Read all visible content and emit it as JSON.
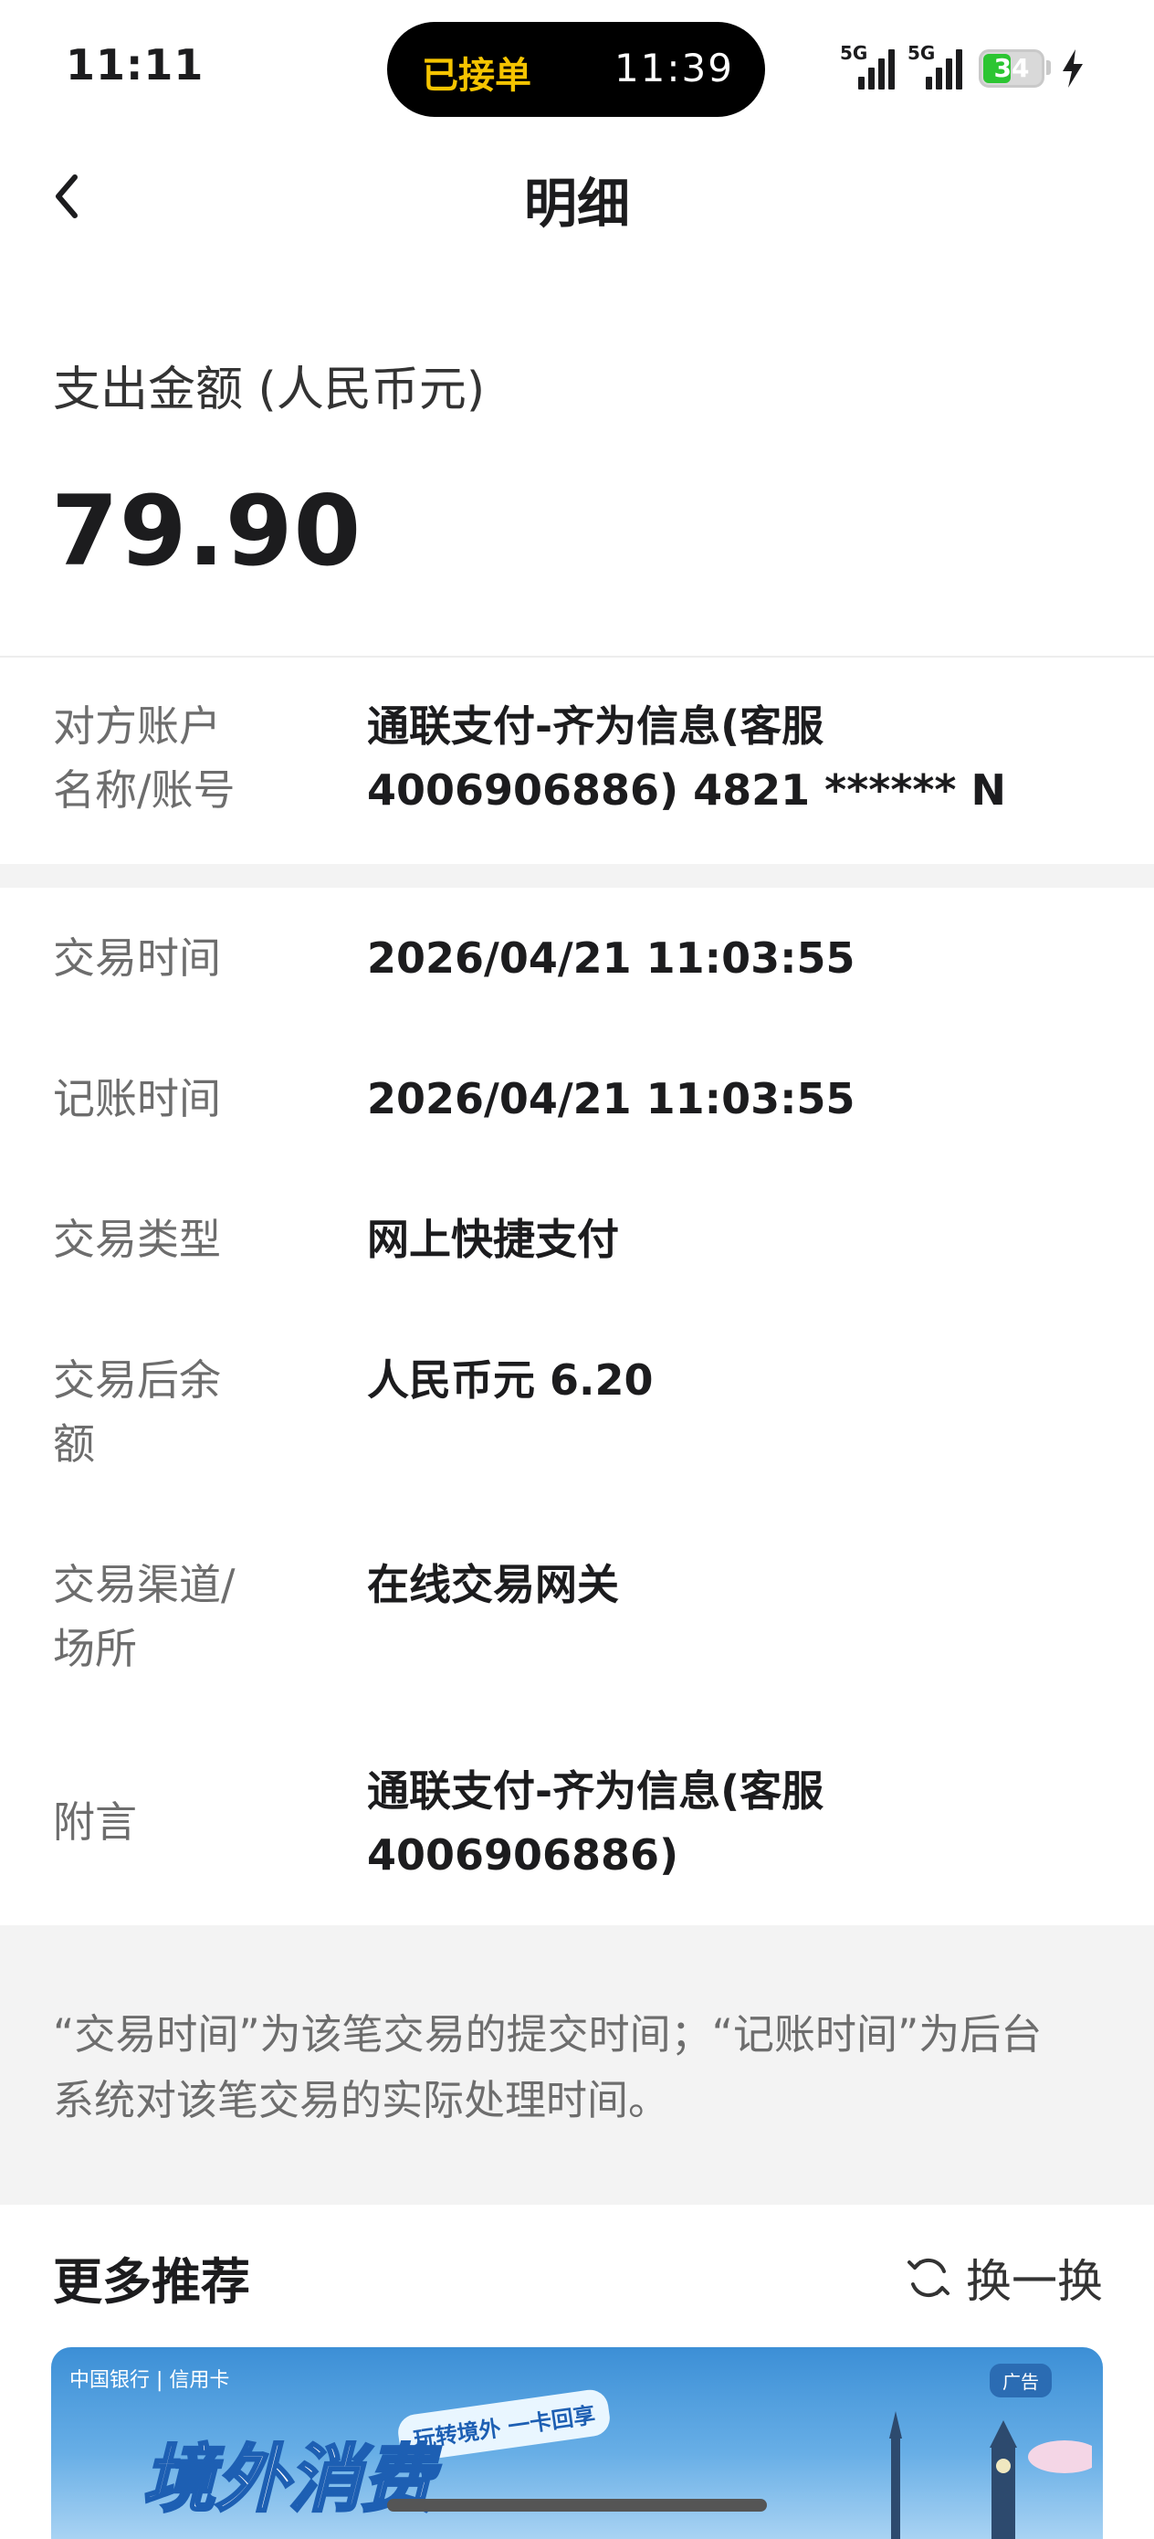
{
  "status_bar": {
    "time": "11:11",
    "island_left": "已接单",
    "island_right": "11:39",
    "signal_1": "5G",
    "signal_2": "5G",
    "battery": "34"
  },
  "header": {
    "title": "明细"
  },
  "amount": {
    "label": "支出金额 (人民币元)",
    "value": "79.90"
  },
  "counterparty": {
    "label_line1": "对方账户",
    "label_line2": "名称/账号",
    "value_line1": "通联支付-齐为信息(客服",
    "value_line2": "4006906886) 4821 ****** N"
  },
  "details": [
    {
      "label": "交易时间",
      "value": "2026/04/21 11:03:55"
    },
    {
      "label": "记账时间",
      "value": "2026/04/21 11:03:55"
    },
    {
      "label": "交易类型",
      "value": "网上快捷支付"
    },
    {
      "label_line1": "交易后余",
      "label_line2": "额",
      "value": "人民币元 6.20"
    },
    {
      "label_line1": "交易渠道/",
      "label_line2": "场所",
      "value": "在线交易网关"
    },
    {
      "label": "附言",
      "value_line1": "通联支付-齐为信息(客服",
      "value_line2": "4006906886)"
    }
  ],
  "note": {
    "line1": "“交易时间”为该笔交易的提交时间；“记账时间”为后台",
    "line2": "系统对该笔交易的实际处理时间。"
  },
  "more": {
    "title": "更多推荐",
    "refresh_label": "换一换"
  },
  "banner": {
    "logo_text": "中国银行 | 信用卡",
    "ad_badge": "广告",
    "bubble": "玩转境外 一卡回享",
    "headline": "境外消费"
  }
}
